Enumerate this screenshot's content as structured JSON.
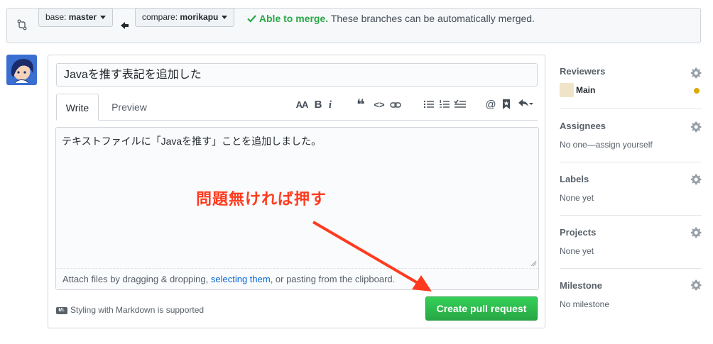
{
  "compare_bar": {
    "base_prefix": "base:",
    "base_branch": "master",
    "compare_prefix": "compare:",
    "compare_branch": "morikapu",
    "merge_ok": "Able to merge.",
    "merge_msg": "These branches can be automatically merged."
  },
  "pr": {
    "title": "Javaを推す表記を追加した",
    "tabs": [
      "Write",
      "Preview"
    ],
    "body": "テキストファイルに「Javaを推す」ことを追加しました。",
    "drop_hint_before": "Attach files by dragging & dropping, ",
    "drop_hint_link": "selecting them",
    "drop_hint_after": ", or pasting from the clipboard.",
    "markdown_note": "Styling with Markdown is supported",
    "markdown_icon": "M↓",
    "submit_label": "Create pull request"
  },
  "toolbar": {
    "header": "AA",
    "bold": "B",
    "italic": "i",
    "quote": "❝",
    "code": "<>",
    "link": "⊂⊃",
    "bullet_list": "☰",
    "numbered_list": "☷",
    "task_list": "☑",
    "mention": "@",
    "reference": "🔖",
    "reply": "↶"
  },
  "annotation": {
    "text": "問題無ければ押す",
    "color": "#ff3b1f"
  },
  "sidebar": {
    "reviewers": {
      "title": "Reviewers",
      "name": "Main",
      "status_color": "#dbab09"
    },
    "assignees": {
      "title": "Assignees",
      "value": "No one—assign yourself"
    },
    "labels": {
      "title": "Labels",
      "value": "None yet"
    },
    "projects": {
      "title": "Projects",
      "value": "None yet"
    },
    "milestone": {
      "title": "Milestone",
      "value": "No milestone"
    }
  },
  "colors": {
    "merge_ok": "#28a745",
    "link": "#0366d6",
    "primary_button": "#28a745"
  }
}
